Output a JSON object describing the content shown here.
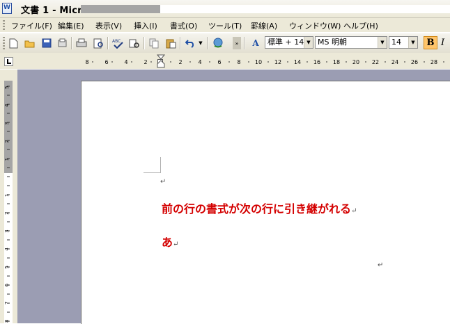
{
  "window": {
    "title": "文書 1 - Microsoft Word"
  },
  "menu": {
    "items": [
      "ファイル(F)",
      "編集(E)",
      "表示(V)",
      "挿入(I)",
      "書式(O)",
      "ツール(T)",
      "罫線(A)",
      "ウィンドウ(W)",
      "ヘルプ(H)"
    ]
  },
  "toolbar": {
    "style_value": "標準 + 14",
    "font_value": "MS 明朝",
    "size_value": "14",
    "bold_label": "B",
    "italic_label": "I",
    "style_glyph": "A"
  },
  "ruler": {
    "labels": [
      "8",
      "6",
      "4",
      "2",
      "2",
      "4",
      "6",
      "8",
      "10",
      "12",
      "14",
      "16",
      "18",
      "20",
      "22",
      "24",
      "26",
      "28"
    ],
    "vlabels": [
      "5",
      "4",
      "3",
      "2",
      "1",
      "1",
      "2",
      "3",
      "4",
      "5",
      "6",
      "7",
      "8"
    ]
  },
  "document": {
    "paragraph_mark": "↵",
    "line1": "前の行の書式が次の行に引き継がれる",
    "line2": "あ"
  },
  "colors": {
    "text_red": "#d40000",
    "bold_active": "#ffc56b",
    "workspace": "#9b9db3"
  }
}
